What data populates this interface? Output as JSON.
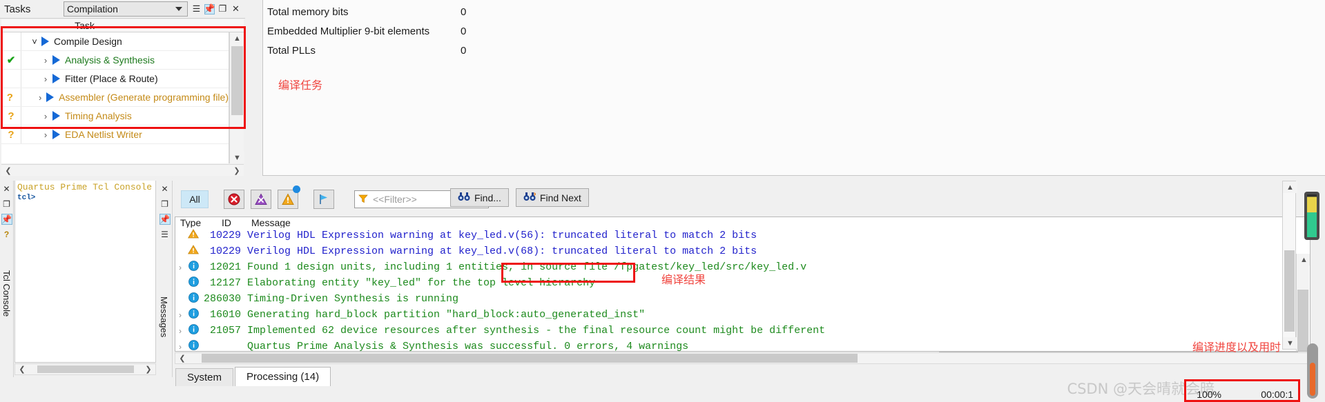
{
  "tasks": {
    "panel_title": "Tasks",
    "flow_selected": "Compilation",
    "column_header": "Task",
    "icons": {
      "menu": "hamburger-icon",
      "pin": "pin-icon",
      "restore": "restore-icon",
      "close": "close-icon"
    },
    "rows": [
      {
        "status": "",
        "label": "Compile Design",
        "color": "dark",
        "indent": 1,
        "chevron": "down"
      },
      {
        "status": "✔",
        "label": "Analysis & Synthesis",
        "color": "green",
        "indent": 2,
        "chevron": "right"
      },
      {
        "status": "",
        "label": "Fitter (Place & Route)",
        "color": "dark",
        "indent": 2,
        "chevron": "right"
      },
      {
        "status": "?",
        "label": "Assembler (Generate programming file)",
        "color": "orange",
        "indent": 2,
        "chevron": "right"
      },
      {
        "status": "?",
        "label": "Timing Analysis",
        "color": "orange",
        "indent": 2,
        "chevron": "right"
      },
      {
        "status": "?",
        "label": "EDA Netlist Writer",
        "color": "orange",
        "indent": 2,
        "chevron": "right"
      }
    ]
  },
  "summary": {
    "rows": [
      {
        "name": "Total memory bits",
        "value": "0"
      },
      {
        "name": "Embedded Multiplier 9-bit elements",
        "value": "0"
      },
      {
        "name": "Total PLLs",
        "value": "0"
      }
    ]
  },
  "annotations": {
    "tasks_note": "编译任务",
    "result_note": "编译结果",
    "progress_note": "编译进度以及用时",
    "watermark": "CSDN @天会晴就会暗"
  },
  "tcl_console": {
    "vertical_label": "Tcl Console",
    "header": "Quartus Prime Tcl Console",
    "prompt": "tcl>"
  },
  "messages": {
    "vertical_label": "Messages",
    "toolbar": {
      "all_label": "All",
      "error_icon": "error-icon",
      "critical_icon": "critical-warning-icon",
      "warning_icon": "warning-icon",
      "flag_icon": "flag-icon",
      "filter_icon": "filter-icon",
      "filter_placeholder": "<<Filter>>",
      "find_label": "Find...",
      "find_next_label": "Find Next"
    },
    "headers": {
      "type": "Type",
      "id": "ID",
      "message": "Message"
    },
    "rows": [
      {
        "icon": "warning",
        "expandable": false,
        "id": "10229",
        "text": "Verilog HDL Expression warning at key_led.v(56): truncated literal to match 2 bits",
        "color": "blue"
      },
      {
        "icon": "warning",
        "expandable": false,
        "id": "10229",
        "text": "Verilog HDL Expression warning at key_led.v(68): truncated literal to match 2 bits",
        "color": "blue"
      },
      {
        "icon": "info",
        "expandable": true,
        "id": "12021",
        "text": "Found 1 design units, including 1 entities, in source file /fpgatest/key_led/src/key_led.v",
        "color": "green"
      },
      {
        "icon": "info",
        "expandable": false,
        "id": "12127",
        "text": "Elaborating entity \"key_led\" for the top level hierarchy",
        "color": "green"
      },
      {
        "icon": "info",
        "expandable": false,
        "id": "286030",
        "text": "Timing-Driven Synthesis is running",
        "color": "green"
      },
      {
        "icon": "info",
        "expandable": true,
        "id": "16010",
        "text": "Generating hard_block partition \"hard_block:auto_generated_inst\"",
        "color": "green"
      },
      {
        "icon": "info",
        "expandable": true,
        "id": "21057",
        "text": "Implemented 62 device resources after synthesis - the final resource count might be different",
        "color": "green"
      },
      {
        "icon": "info",
        "expandable": true,
        "id": "",
        "text": "Quartus Prime Analysis & Synthesis was successful. 0 errors, 4 warnings",
        "color": "green"
      }
    ],
    "tabs": [
      {
        "label": "System",
        "active": false
      },
      {
        "label": "Processing (14)",
        "active": true
      }
    ]
  },
  "status_bar": {
    "progress_percent": "100%",
    "elapsed_time": "00:00:1"
  },
  "colors": {
    "accent_blue": "#1569d6",
    "ok_green": "#17a317",
    "warn_orange": "#e8a317",
    "annotation_red": "#f0453f",
    "msg_blue": "#2222cc",
    "msg_green": "#1d8a1d"
  }
}
